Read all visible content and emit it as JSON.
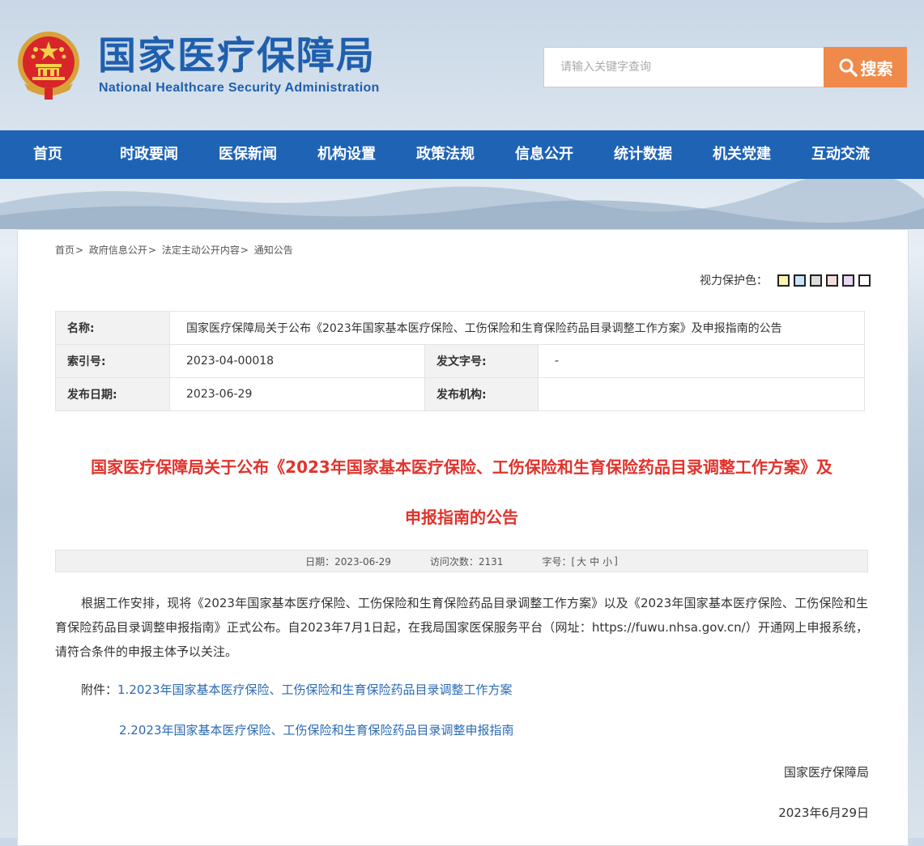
{
  "header": {
    "title": "国家医疗保障局",
    "subtitle": "National Healthcare Security Administration",
    "search": {
      "placeholder": "请输入关键字查询",
      "button_label": "搜索"
    }
  },
  "nav": {
    "items": [
      "首页",
      "时政要闻",
      "医保新闻",
      "机构设置",
      "政策法规",
      "信息公开",
      "统计数据",
      "机关党建",
      "互动交流"
    ]
  },
  "breadcrumb": [
    "首页",
    "政府信息公开",
    "法定主动公开内容",
    "通知公告"
  ],
  "eyecare": {
    "label": "视力保护色：",
    "colors": [
      "#fbf5b0",
      "#c7e3f7",
      "#dcdcdc",
      "#f6dede",
      "#e8d6f3",
      "#ffffff"
    ]
  },
  "meta": {
    "name_label": "名称:",
    "name_value": "国家医疗保障局关于公布《2023年国家基本医疗保险、工伤保险和生育保险药品目录调整工作方案》及申报指南的公告",
    "index_label": "索引号:",
    "index_value": "2023-04-00018",
    "doc_no_label": "发文字号:",
    "doc_no_value": "-",
    "date_label": "发布日期:",
    "date_value": "2023-06-29",
    "org_label": "发布机构:",
    "org_value": ""
  },
  "article": {
    "title_line1": "国家医疗保障局关于公布《2023年国家基本医疗保险、工伤保险和生育保险药品目录调整工作方案》及",
    "title_line2": "申报指南的公告",
    "date": "日期：2023-06-29",
    "visits": "访问次数：2131",
    "font_label": "字号：[",
    "font_large": "大",
    "font_medium": "中",
    "font_small": "小",
    "font_close": "]",
    "body": "根据工作安排，现将《2023年国家基本医疗保险、工伤保险和生育保险药品目录调整工作方案》以及《2023年国家基本医疗保险、工伤保险和生育保险药品目录调整申报指南》正式公布。自2023年7月1日起，在我局国家医保服务平台（网址：https://fuwu.nhsa.gov.cn/）开通网上申报系统，请符合条件的申报主体予以关注。",
    "attachment_label": "附件：",
    "attachments": [
      "1.2023年国家基本医疗保险、工伤保险和生育保险药品目录调整工作方案",
      "2.2023年国家基本医疗保险、工伤保险和生育保险药品目录调整申报指南"
    ],
    "signature": "国家医疗保障局",
    "sign_date": "2023年6月29日"
  },
  "icons": {
    "emblem": "national-emblem-icon",
    "search": "search-icon"
  },
  "colors": {
    "brand_blue": "#1f63b5",
    "title_red": "#e0332c",
    "search_orange": "#ef8a4a",
    "link_blue": "#2a6ab3"
  }
}
